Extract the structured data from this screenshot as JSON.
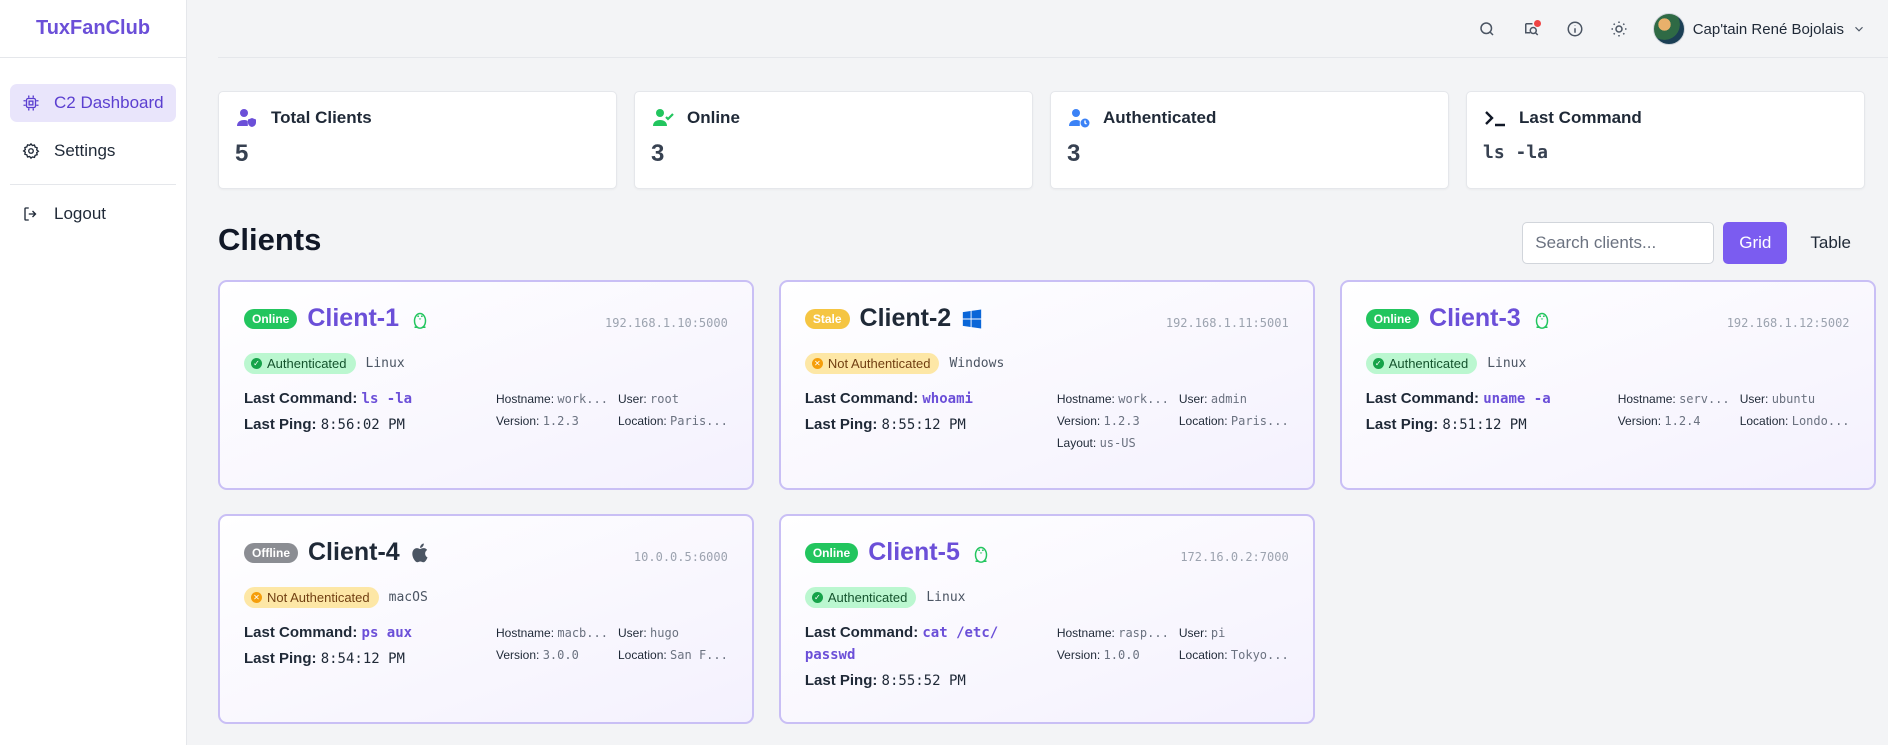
{
  "app": {
    "brand": "TuxFanClub"
  },
  "sidebar": {
    "items": [
      {
        "label": "C2 Dashboard",
        "icon": "chip-icon"
      },
      {
        "label": "Settings",
        "icon": "gear-icon"
      },
      {
        "label": "Logout",
        "icon": "logout-icon"
      }
    ]
  },
  "header": {
    "user_name": "Cap'tain René Bojolais"
  },
  "stats": {
    "total": {
      "label": "Total Clients",
      "value": "5"
    },
    "online": {
      "label": "Online",
      "value": "3"
    },
    "authenticated": {
      "label": "Authenticated",
      "value": "3"
    },
    "last_command": {
      "label": "Last Command",
      "value": "ls -la"
    }
  },
  "clients_section": {
    "title": "Clients",
    "search_placeholder": "Search clients...",
    "grid_label": "Grid",
    "table_label": "Table"
  },
  "labels": {
    "last_command": "Last Command:",
    "last_ping": "Last Ping:",
    "hostname": "Hostname:",
    "user": "User:",
    "version": "Version:",
    "location": "Location:",
    "layout": "Layout:"
  },
  "clients": [
    {
      "status": "Online",
      "name": "Client-1",
      "os_icon": "linux-icon",
      "address": "192.168.1.10:5000",
      "auth": "Authenticated",
      "os": "Linux",
      "last_command": "ls -la",
      "last_ping": "8:56:02 PM",
      "hostname": "work...",
      "user": "root",
      "version": "1.2.3",
      "location": "Paris...",
      "layout": ""
    },
    {
      "status": "Stale",
      "name": "Client-2",
      "os_icon": "windows-icon",
      "address": "192.168.1.11:5001",
      "auth": "Not Authenticated",
      "os": "Windows",
      "last_command": "whoami",
      "last_ping": "8:55:12 PM",
      "hostname": "work...",
      "user": "admin",
      "version": "1.2.3",
      "location": "Paris...",
      "layout": "us-US"
    },
    {
      "status": "Online",
      "name": "Client-3",
      "os_icon": "linux-icon",
      "address": "192.168.1.12:5002",
      "auth": "Authenticated",
      "os": "Linux",
      "last_command": "uname -a",
      "last_ping": "8:51:12 PM",
      "hostname": "serv...",
      "user": "ubuntu",
      "version": "1.2.4",
      "location": "Londo...",
      "layout": ""
    },
    {
      "status": "Offline",
      "name": "Client-4",
      "os_icon": "apple-icon",
      "address": "10.0.0.5:6000",
      "auth": "Not Authenticated",
      "os": "macOS",
      "last_command": "ps aux",
      "last_ping": "8:54:12 PM",
      "hostname": "macb...",
      "user": "hugo",
      "version": "3.0.0",
      "location": "San F...",
      "layout": ""
    },
    {
      "status": "Online",
      "name": "Client-5",
      "os_icon": "linux-icon",
      "address": "172.16.0.2:7000",
      "auth": "Authenticated",
      "os": "Linux",
      "last_command": "cat /etc/ passwd",
      "last_ping": "8:55:52 PM",
      "hostname": "rasp...",
      "user": "pi",
      "version": "1.0.0",
      "location": "Tokyo...",
      "layout": ""
    }
  ],
  "colors": {
    "accent": "#7b5cf0",
    "online": "#22c55e",
    "stale": "#f5c542",
    "offline": "#8b8d93"
  }
}
